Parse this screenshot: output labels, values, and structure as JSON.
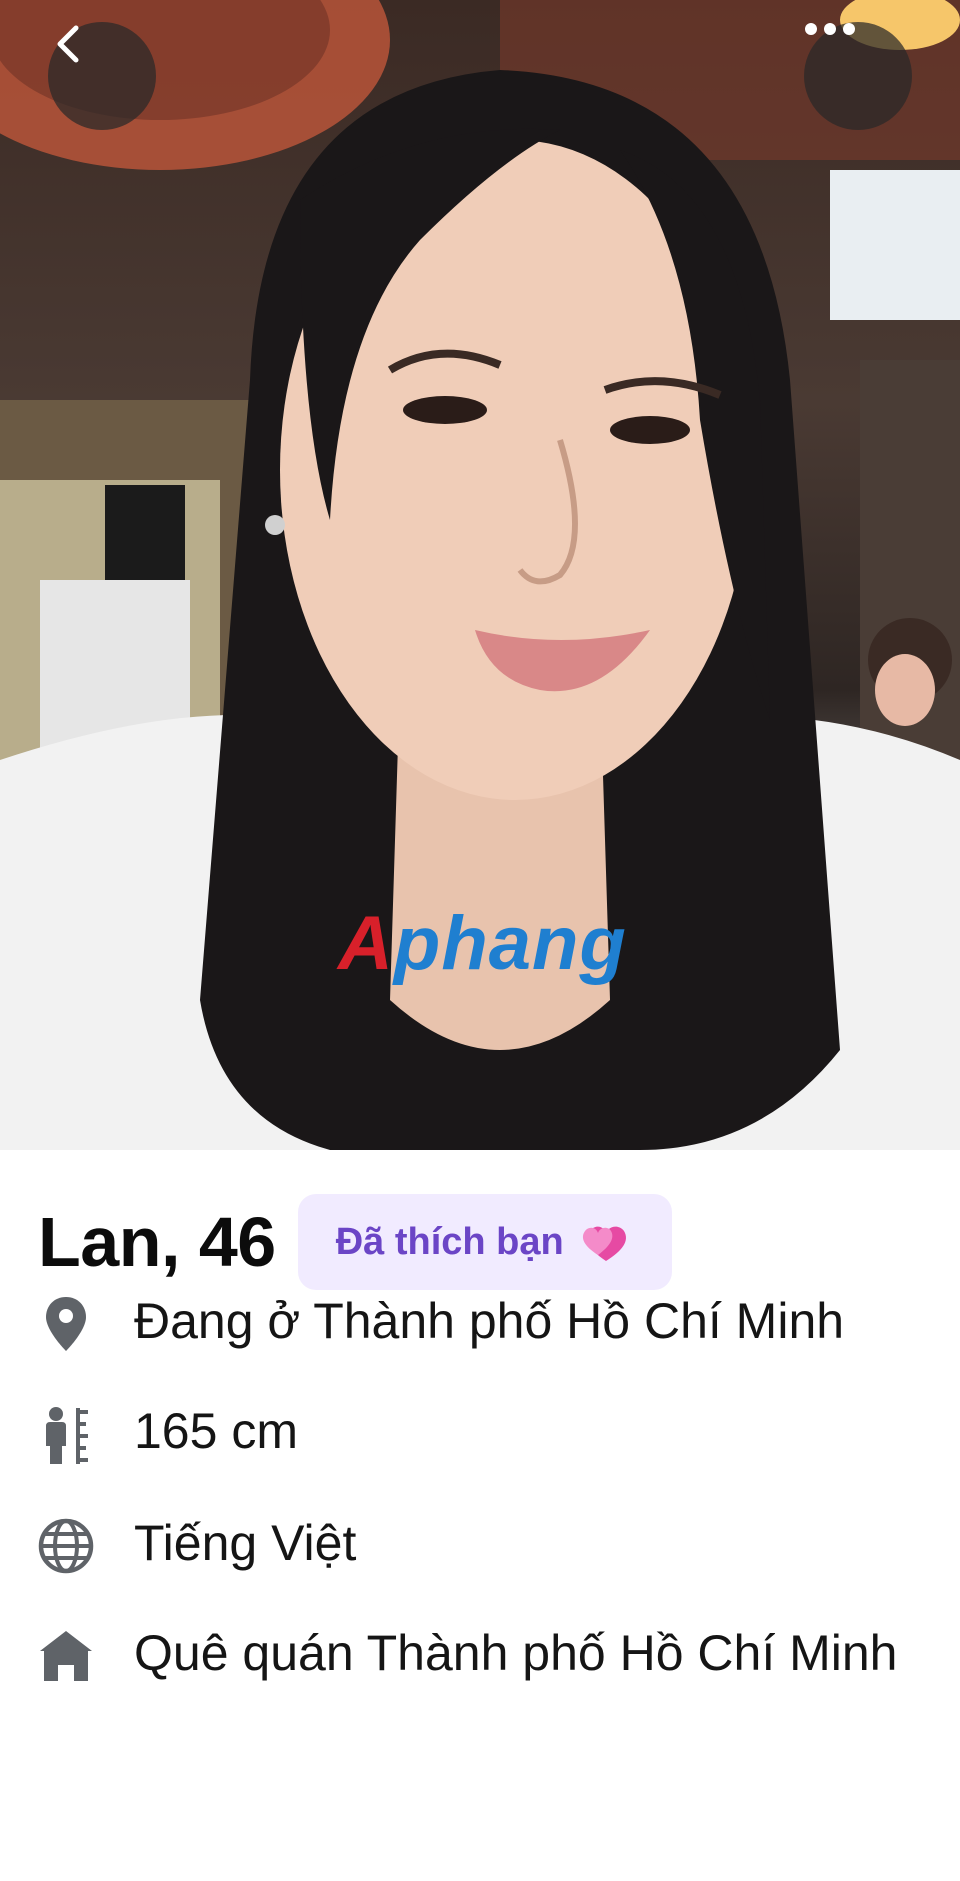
{
  "header": {
    "back_icon": "chevron-left-icon",
    "more_icon": "more-horizontal-icon"
  },
  "photo": {
    "watermark_part1": "A",
    "watermark_part2": "phang"
  },
  "profile": {
    "name_age": "Lan, 46",
    "liked_badge": "Đã thích bạn",
    "liked_icon": "heart-icon"
  },
  "details": [
    {
      "icon": "location-pin-icon",
      "text": "Đang ở Thành phố Hồ Chí Minh"
    },
    {
      "icon": "height-icon",
      "text": "165 cm"
    },
    {
      "icon": "globe-icon",
      "text": "Tiếng Việt"
    },
    {
      "icon": "home-icon",
      "text": "Quê quán Thành phố Hồ Chí Minh"
    }
  ],
  "colors": {
    "badge_bg": "#f1ebff",
    "badge_text": "#6b45c6",
    "icon_gray": "#5f6368"
  }
}
